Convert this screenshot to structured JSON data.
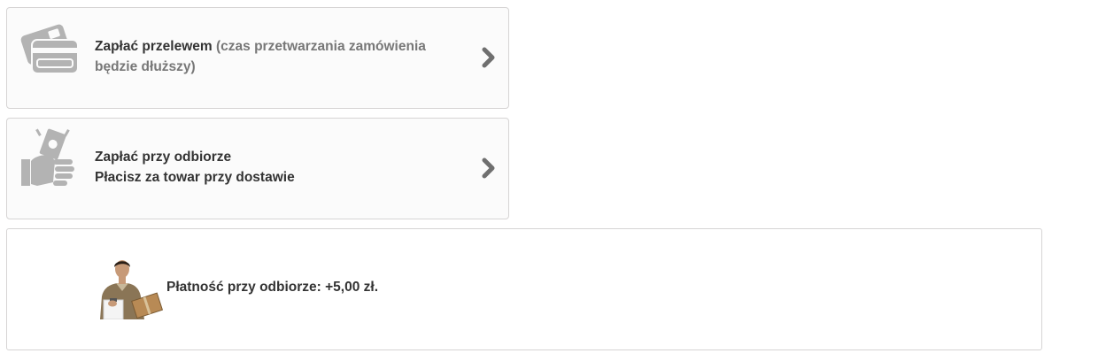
{
  "payment_options": [
    {
      "title": "Zapłać przelewem",
      "note": "(czas przetwarzania zamówienia będzie dłuższy)",
      "icon": "credit-card-icon"
    },
    {
      "title": "Zapłać przy odbiorze",
      "subtitle": "Płacisz za towar przy dostawie",
      "icon": "cash-in-hand-icon"
    }
  ],
  "cod_info": {
    "text": "Płatność przy odbiorze: +5,00 zł.",
    "image": "courier-with-package-photo"
  },
  "colors": {
    "icon_gray": "#b3b3b3",
    "chevron": "#6f6f6f",
    "text_dark": "#333333",
    "text_muted": "#777777",
    "border": "#d6d4d4"
  }
}
